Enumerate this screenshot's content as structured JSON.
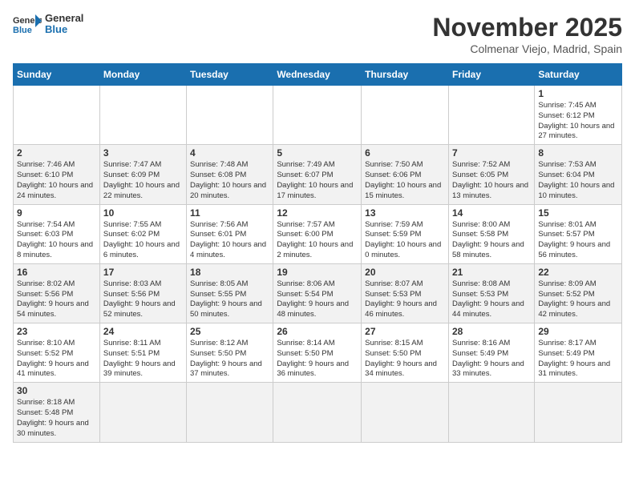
{
  "header": {
    "logo_general": "General",
    "logo_blue": "Blue",
    "month_title": "November 2025",
    "location": "Colmenar Viejo, Madrid, Spain"
  },
  "weekdays": [
    "Sunday",
    "Monday",
    "Tuesday",
    "Wednesday",
    "Thursday",
    "Friday",
    "Saturday"
  ],
  "weeks": [
    [
      {
        "day": "",
        "info": ""
      },
      {
        "day": "",
        "info": ""
      },
      {
        "day": "",
        "info": ""
      },
      {
        "day": "",
        "info": ""
      },
      {
        "day": "",
        "info": ""
      },
      {
        "day": "",
        "info": ""
      },
      {
        "day": "1",
        "info": "Sunrise: 7:45 AM\nSunset: 6:12 PM\nDaylight: 10 hours and 27 minutes."
      }
    ],
    [
      {
        "day": "2",
        "info": "Sunrise: 7:46 AM\nSunset: 6:10 PM\nDaylight: 10 hours and 24 minutes."
      },
      {
        "day": "3",
        "info": "Sunrise: 7:47 AM\nSunset: 6:09 PM\nDaylight: 10 hours and 22 minutes."
      },
      {
        "day": "4",
        "info": "Sunrise: 7:48 AM\nSunset: 6:08 PM\nDaylight: 10 hours and 20 minutes."
      },
      {
        "day": "5",
        "info": "Sunrise: 7:49 AM\nSunset: 6:07 PM\nDaylight: 10 hours and 17 minutes."
      },
      {
        "day": "6",
        "info": "Sunrise: 7:50 AM\nSunset: 6:06 PM\nDaylight: 10 hours and 15 minutes."
      },
      {
        "day": "7",
        "info": "Sunrise: 7:52 AM\nSunset: 6:05 PM\nDaylight: 10 hours and 13 minutes."
      },
      {
        "day": "8",
        "info": "Sunrise: 7:53 AM\nSunset: 6:04 PM\nDaylight: 10 hours and 10 minutes."
      }
    ],
    [
      {
        "day": "9",
        "info": "Sunrise: 7:54 AM\nSunset: 6:03 PM\nDaylight: 10 hours and 8 minutes."
      },
      {
        "day": "10",
        "info": "Sunrise: 7:55 AM\nSunset: 6:02 PM\nDaylight: 10 hours and 6 minutes."
      },
      {
        "day": "11",
        "info": "Sunrise: 7:56 AM\nSunset: 6:01 PM\nDaylight: 10 hours and 4 minutes."
      },
      {
        "day": "12",
        "info": "Sunrise: 7:57 AM\nSunset: 6:00 PM\nDaylight: 10 hours and 2 minutes."
      },
      {
        "day": "13",
        "info": "Sunrise: 7:59 AM\nSunset: 5:59 PM\nDaylight: 10 hours and 0 minutes."
      },
      {
        "day": "14",
        "info": "Sunrise: 8:00 AM\nSunset: 5:58 PM\nDaylight: 9 hours and 58 minutes."
      },
      {
        "day": "15",
        "info": "Sunrise: 8:01 AM\nSunset: 5:57 PM\nDaylight: 9 hours and 56 minutes."
      }
    ],
    [
      {
        "day": "16",
        "info": "Sunrise: 8:02 AM\nSunset: 5:56 PM\nDaylight: 9 hours and 54 minutes."
      },
      {
        "day": "17",
        "info": "Sunrise: 8:03 AM\nSunset: 5:56 PM\nDaylight: 9 hours and 52 minutes."
      },
      {
        "day": "18",
        "info": "Sunrise: 8:05 AM\nSunset: 5:55 PM\nDaylight: 9 hours and 50 minutes."
      },
      {
        "day": "19",
        "info": "Sunrise: 8:06 AM\nSunset: 5:54 PM\nDaylight: 9 hours and 48 minutes."
      },
      {
        "day": "20",
        "info": "Sunrise: 8:07 AM\nSunset: 5:53 PM\nDaylight: 9 hours and 46 minutes."
      },
      {
        "day": "21",
        "info": "Sunrise: 8:08 AM\nSunset: 5:53 PM\nDaylight: 9 hours and 44 minutes."
      },
      {
        "day": "22",
        "info": "Sunrise: 8:09 AM\nSunset: 5:52 PM\nDaylight: 9 hours and 42 minutes."
      }
    ],
    [
      {
        "day": "23",
        "info": "Sunrise: 8:10 AM\nSunset: 5:52 PM\nDaylight: 9 hours and 41 minutes."
      },
      {
        "day": "24",
        "info": "Sunrise: 8:11 AM\nSunset: 5:51 PM\nDaylight: 9 hours and 39 minutes."
      },
      {
        "day": "25",
        "info": "Sunrise: 8:12 AM\nSunset: 5:50 PM\nDaylight: 9 hours and 37 minutes."
      },
      {
        "day": "26",
        "info": "Sunrise: 8:14 AM\nSunset: 5:50 PM\nDaylight: 9 hours and 36 minutes."
      },
      {
        "day": "27",
        "info": "Sunrise: 8:15 AM\nSunset: 5:50 PM\nDaylight: 9 hours and 34 minutes."
      },
      {
        "day": "28",
        "info": "Sunrise: 8:16 AM\nSunset: 5:49 PM\nDaylight: 9 hours and 33 minutes."
      },
      {
        "day": "29",
        "info": "Sunrise: 8:17 AM\nSunset: 5:49 PM\nDaylight: 9 hours and 31 minutes."
      }
    ],
    [
      {
        "day": "30",
        "info": "Sunrise: 8:18 AM\nSunset: 5:48 PM\nDaylight: 9 hours and 30 minutes."
      },
      {
        "day": "",
        "info": ""
      },
      {
        "day": "",
        "info": ""
      },
      {
        "day": "",
        "info": ""
      },
      {
        "day": "",
        "info": ""
      },
      {
        "day": "",
        "info": ""
      },
      {
        "day": "",
        "info": ""
      }
    ]
  ]
}
